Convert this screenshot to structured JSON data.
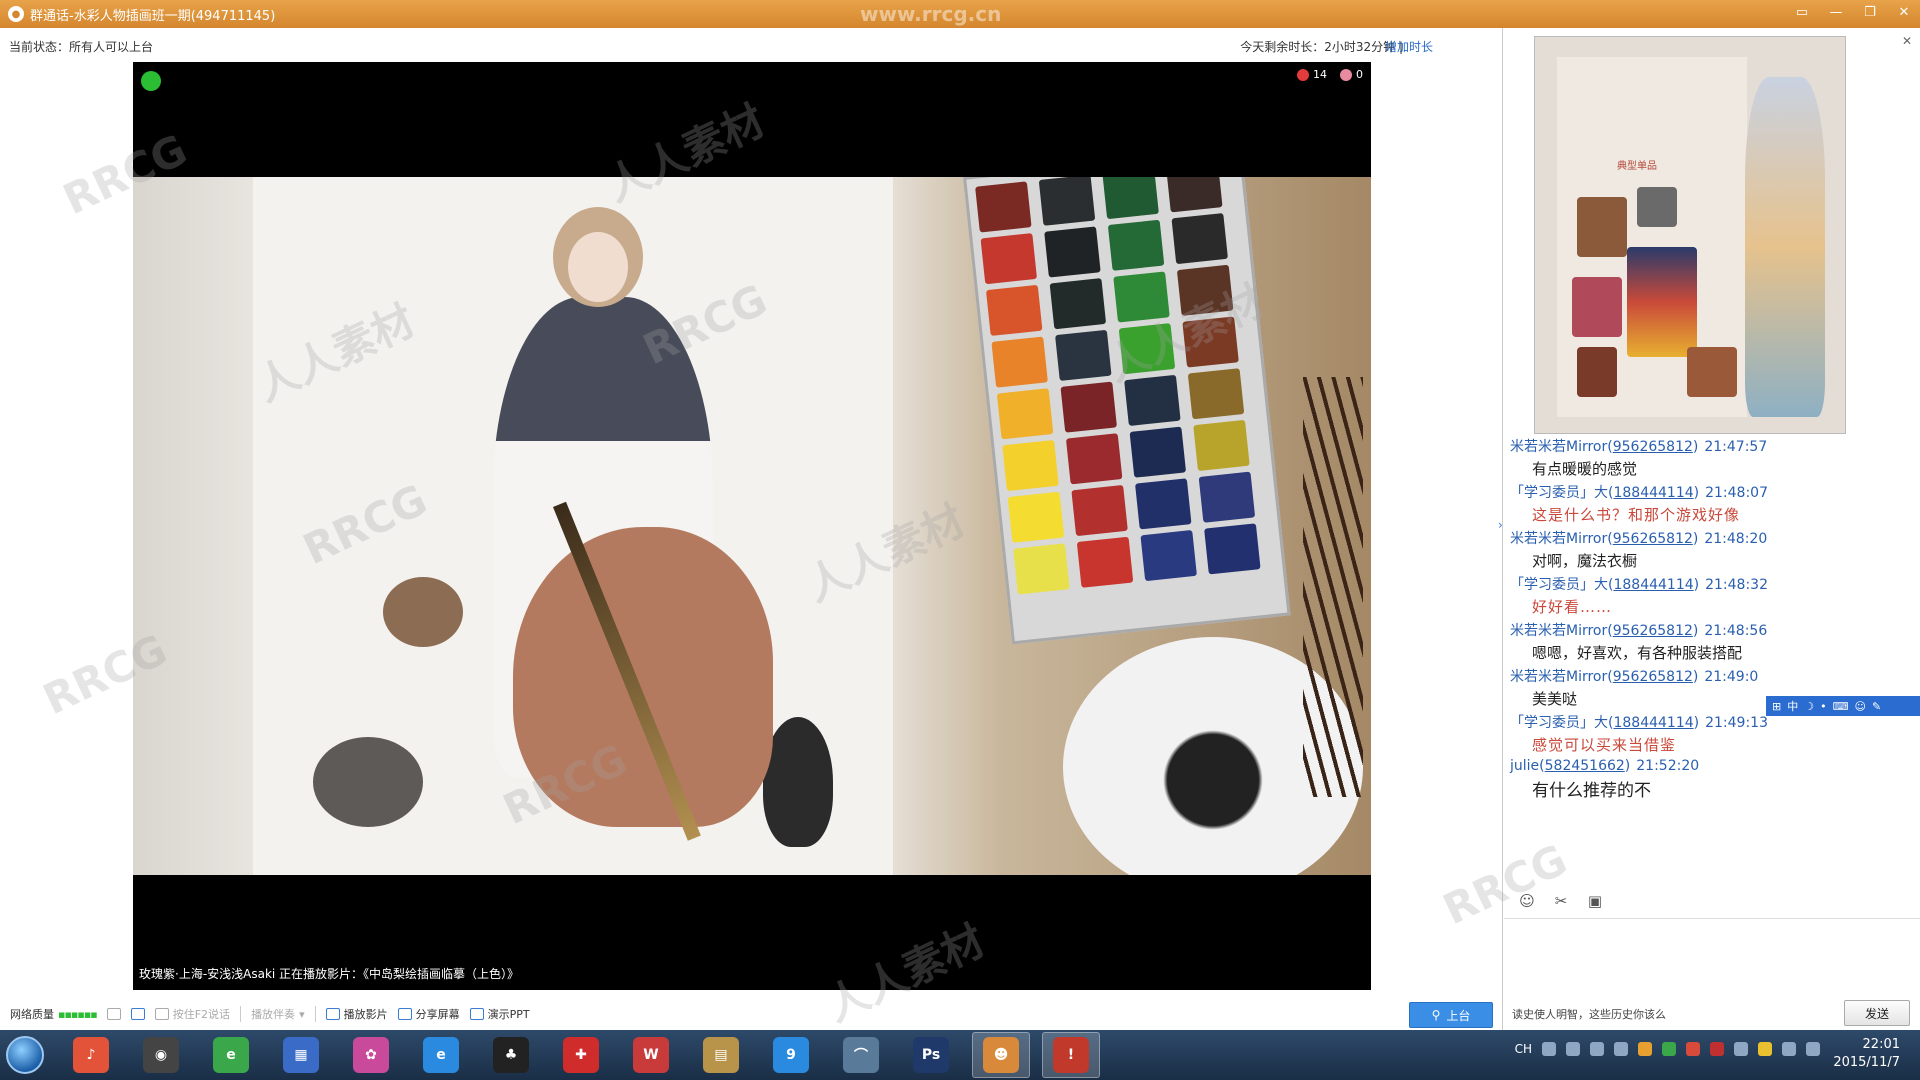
{
  "window": {
    "title": "群通话-水彩人物插画班一期(494711145)"
  },
  "status": {
    "current_status": "当前状态：所有人可以上台",
    "time_left": "今天剩余时长：2小时32分钟 |",
    "add_time": "增加时长"
  },
  "video": {
    "flower_count": "14",
    "egg_count": "0",
    "caption": "玫瑰紫·上海-安浅浅Asaki  正在播放影片：《中岛梨绘插画临摹（上色）》"
  },
  "toolbar": {
    "network_quality": "网络质量",
    "quality_bars": "▪▪▪▪▪▪",
    "hold_to_talk": "按住F2说话",
    "play_accompaniment": "播放伴奏",
    "play_movie": "播放影片",
    "share_screen": "分享屏幕",
    "present_ppt": "演示PPT",
    "join_stage": "上台"
  },
  "doc_preview": {
    "heading": "典型单品"
  },
  "chat": {
    "messages": [
      {
        "name": "米若米若Mirror(",
        "qq": "956265812",
        "close": ")",
        "time": "21:47:57",
        "text": "有点暖暖的感觉",
        "style": "normal"
      },
      {
        "name": "「学习委员」大(",
        "qq": "188444114",
        "close": ")",
        "time": "21:48:07",
        "text": "这是什么书？和那个游戏好像",
        "style": "red"
      },
      {
        "name": "米若米若Mirror(",
        "qq": "956265812",
        "close": ")",
        "time": "21:48:20",
        "text": "对啊，魔法衣橱",
        "style": "normal"
      },
      {
        "name": "「学习委员」大(",
        "qq": "188444114",
        "close": ")",
        "time": "21:48:32",
        "text": "好好看……",
        "style": "red"
      },
      {
        "name": "米若米若Mirror(",
        "qq": "956265812",
        "close": ")",
        "time": "21:48:56",
        "text": "嗯嗯，好喜欢，有各种服装搭配",
        "style": "normal"
      },
      {
        "name": "米若米若Mirror(",
        "qq": "956265812",
        "close": ")",
        "time": "21:49:0",
        "text": "美美哒",
        "style": "normal"
      },
      {
        "name": "「学习委员」大(",
        "qq": "188444114",
        "close": ")",
        "time": "21:49:13",
        "text": "感觉可以买来当借鉴",
        "style": "red"
      },
      {
        "name": "julie(",
        "qq": "582451662",
        "close": ")",
        "time": "21:52:20",
        "text": "有什么推荐的不",
        "style": "big"
      }
    ],
    "input_hint": "读史使人明智，这些历史你该么",
    "send_label": "发送"
  },
  "ime": {
    "label": "中"
  },
  "taskbar": {
    "tray_lang": "CH",
    "clock_time": "22:01",
    "clock_date": "2015/11/7",
    "apps": [
      {
        "name": "qq-music-app",
        "color": "#e2533a",
        "glyph": "♪"
      },
      {
        "name": "webcam-app",
        "color": "#444444",
        "glyph": "◉"
      },
      {
        "name": "browser-360-app",
        "color": "#3aa84a",
        "glyph": "e"
      },
      {
        "name": "file-manager-app",
        "color": "#3a6cc7",
        "glyph": "▦"
      },
      {
        "name": "picasa-app",
        "color": "#c94a9a",
        "glyph": "✿"
      },
      {
        "name": "ie-app",
        "color": "#2a8ae0",
        "glyph": "e"
      },
      {
        "name": "qq-app",
        "color": "#222222",
        "glyph": "♣"
      },
      {
        "name": "gift-app",
        "color": "#d02c2c",
        "glyph": "✚"
      },
      {
        "name": "wps-app",
        "color": "#c93a3a",
        "glyph": "W"
      },
      {
        "name": "calculator-app",
        "color": "#b8944a",
        "glyph": "▤"
      },
      {
        "name": "image-viewer-app",
        "color": "#2a8ae0",
        "glyph": "9"
      },
      {
        "name": "network-app",
        "color": "#5a7a9a",
        "glyph": "⌒"
      },
      {
        "name": "photoshop-app",
        "color": "#1f3a6a",
        "glyph": "Ps"
      },
      {
        "name": "paint-app",
        "color": "#d88a3a",
        "glyph": "☻"
      },
      {
        "name": "yy-voice-app",
        "color": "#c0392b",
        "glyph": "!"
      }
    ]
  },
  "watermark": {
    "text": "www.rrcg.cn"
  },
  "colors": {
    "titlebar": "#d4862e",
    "link": "#2a6cc7",
    "red_text": "#c9483a",
    "live_green": "#2bbd34"
  }
}
